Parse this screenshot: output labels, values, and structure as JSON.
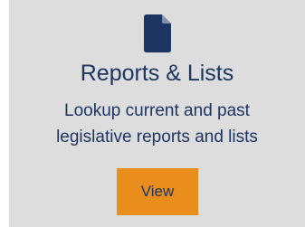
{
  "card": {
    "icon": "document-icon",
    "title": "Reports & Lists",
    "description_line1": "Lookup current and past",
    "description_line2": "legislative reports and lists",
    "button_label": "View",
    "colors": {
      "background": "#dddddd",
      "text": "#1c3562",
      "button": "#e98e1c"
    }
  }
}
